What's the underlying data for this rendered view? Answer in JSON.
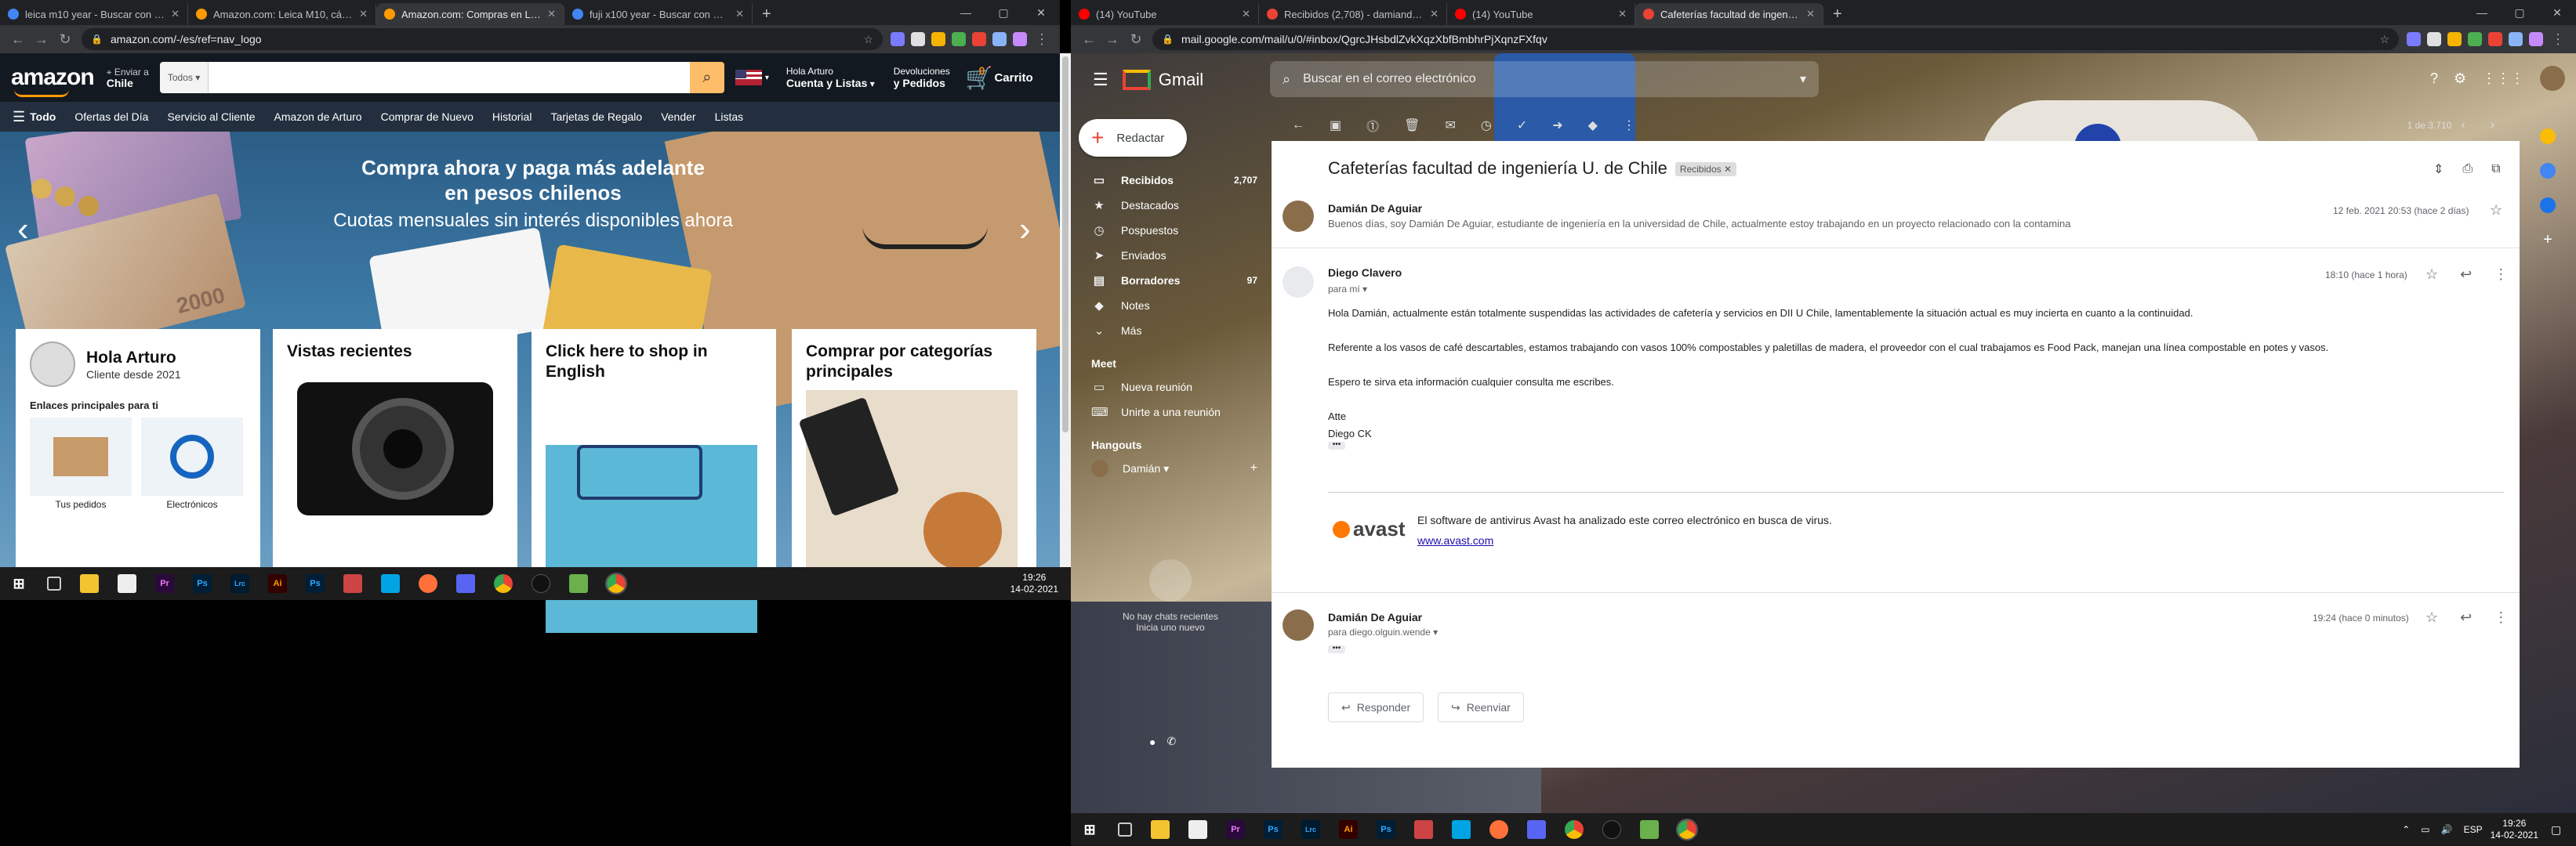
{
  "left_browser": {
    "tabs": [
      {
        "label": "leica m10 year - Buscar con Goo",
        "active": false,
        "fav": "#4285f4"
      },
      {
        "label": "Amazon.com: Leica M10, cámara",
        "active": false,
        "fav": "#ff9900"
      },
      {
        "label": "Amazon.com: Compras en Línea",
        "active": true,
        "fav": "#ff9900"
      },
      {
        "label": "fuji x100 year - Buscar con Goo",
        "active": false,
        "fav": "#4285f4"
      }
    ],
    "url": "amazon.com/-/es/ref=nav_logo"
  },
  "amazon": {
    "logo": "amazon",
    "deliver_line1": "Enviar a",
    "deliver_line2": "Chile",
    "search_category": "Todos",
    "account_line1": "Hola Arturo",
    "account_line2": "Cuenta y Listas",
    "returns_line1": "Devoluciones",
    "returns_line2": "y Pedidos",
    "cart_label": "Carrito",
    "cart_count": "0",
    "subnav": [
      "Todo",
      "Ofertas del Día",
      "Servicio al Cliente",
      "Amazon de Arturo",
      "Comprar de Nuevo",
      "Historial",
      "Tarjetas de Regalo",
      "Vender",
      "Listas"
    ],
    "hero_line1": "Compra ahora y paga más adelante",
    "hero_line2": "en pesos chilenos",
    "hero_line3": "Cuotas mensuales sin interés disponibles ahora",
    "card1_title": "Hola Arturo",
    "card1_sub": "Cliente desde 2021",
    "card1_links": "Enlaces principales para ti",
    "card1_item1": "Tus pedidos",
    "card1_item2": "Electrónicos",
    "card2_title": "Vistas recientes",
    "card3_title": "Click here to shop in English",
    "card4_title": "Comprar por categorías principales",
    "banknote": "2000"
  },
  "left_taskbar": {
    "time": "19:26",
    "date": "14-02-2021",
    "icons": [
      "Pr",
      "Ps",
      "Lrc",
      "Ai",
      "Ps"
    ]
  },
  "right_browser": {
    "tabs": [
      {
        "label": "(14) YouTube",
        "active": false,
        "fav": "#ff0000"
      },
      {
        "label": "Recibidos (2,708) - damiandeag",
        "active": false,
        "fav": "#ea4335"
      },
      {
        "label": "(14) YouTube",
        "active": false,
        "fav": "#ff0000"
      },
      {
        "label": "Cafeterías facultad de ingeniería",
        "active": true,
        "fav": "#ea4335"
      }
    ],
    "url": "mail.google.com/mail/u/0/#inbox/QgrcJHsbdlZvkXqzXbfBmbhrPjXqnzFXfqv"
  },
  "gmail": {
    "product": "Gmail",
    "search_placeholder": "Buscar en el correo electrónico",
    "compose": "Redactar",
    "nav": [
      {
        "label": "Recibidos",
        "count": "2,707",
        "icon": "inbox-icon",
        "glyph": "▭",
        "bold": true
      },
      {
        "label": "Destacados",
        "count": "",
        "icon": "star-icon",
        "glyph": "★",
        "bold": false
      },
      {
        "label": "Pospuestos",
        "count": "",
        "icon": "clock-icon",
        "glyph": "◷",
        "bold": false
      },
      {
        "label": "Enviados",
        "count": "",
        "icon": "send-icon",
        "glyph": "➤",
        "bold": false
      },
      {
        "label": "Borradores",
        "count": "97",
        "icon": "draft-icon",
        "glyph": "▤",
        "bold": true
      },
      {
        "label": "Notes",
        "count": "",
        "icon": "label-icon",
        "glyph": "◆",
        "bold": false
      },
      {
        "label": "Más",
        "count": "",
        "icon": "chevron-down-icon",
        "glyph": "⌄",
        "bold": false
      }
    ],
    "meet_title": "Meet",
    "meet_new": "Nueva reunión",
    "meet_join": "Unirte a una reunión",
    "hangouts_title": "Hangouts",
    "hangouts_user": "Damián",
    "no_chats": "No hay chats recientes",
    "start_chat": "Inicia uno nuevo",
    "page_counter": "1 de 3,710",
    "subject": "Cafeterías facultad de ingeniería U. de Chile",
    "label": "Recibidos",
    "messages": [
      {
        "from": "Damián De Aguiar",
        "snippet": "Buenos días, soy Damián De Aguiar, estudiante de ingeniería en la universidad de Chile, actualmente estoy trabajando en un proyecto relacionado con la contamina",
        "time": "12 feb. 2021 20:53 (hace 2 días)"
      },
      {
        "from": "Diego Clavero",
        "to": "para mí",
        "time": "18:10 (hace 1 hora)"
      },
      {
        "from": "Damián De Aguiar",
        "to": "para diego.olguin.wende",
        "time": "19:24 (hace 0 minutos)"
      }
    ],
    "body_p1": "Hola Damián, actualmente están totalmente suspendidas las actividades de cafetería y servicios en DII U Chile, lamentablemente la situación actual es muy incierta en cuanto a la continuidad.",
    "body_p2": "Referente a los vasos de café descartables, estamos trabajando con vasos 100% compostables y paletillas de madera, el proveedor con el cual trabajamos es Food Pack, manejan una línea compostable en potes y vasos.",
    "body_p3": "Espero te sirva eta información cualquier consulta me escribes.",
    "body_sign1": "Atte",
    "body_sign2": "Diego CK",
    "avast_logo": "avast",
    "avast_text": "El software de antivirus Avast ha analizado este correo electrónico en busca de virus.",
    "avast_link": "www.avast.com",
    "reply": "Responder",
    "forward": "Reenviar"
  },
  "right_taskbar": {
    "time": "19:26",
    "date": "14-02-2021",
    "lang": "ESP",
    "icons": [
      "Pr",
      "Ps",
      "Lrc",
      "Ai",
      "Ps"
    ]
  },
  "colors": {
    "amazon_dark": "#131921",
    "amazon_nav": "#232f3e",
    "amazon_orange": "#febd69",
    "chrome_dark": "#202124",
    "gmail_red": "#ea4335"
  }
}
